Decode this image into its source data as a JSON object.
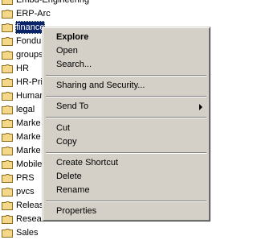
{
  "tree": {
    "folders": [
      {
        "label": "Embd-Engineering",
        "selected": false
      },
      {
        "label": "ERP-Arc",
        "selected": false
      },
      {
        "label": "finance",
        "selected": true
      },
      {
        "label": "Fondu",
        "selected": false
      },
      {
        "label": "groups",
        "selected": false
      },
      {
        "label": "HR",
        "selected": false
      },
      {
        "label": "HR-Pri",
        "selected": false
      },
      {
        "label": "Human",
        "selected": false
      },
      {
        "label": "legal",
        "selected": false
      },
      {
        "label": "Marke",
        "selected": false
      },
      {
        "label": "Marke",
        "selected": false
      },
      {
        "label": "Marke",
        "selected": false
      },
      {
        "label": "Mobile",
        "selected": false
      },
      {
        "label": "PRS",
        "selected": false
      },
      {
        "label": "pvcs",
        "selected": false
      },
      {
        "label": "Releas",
        "selected": false
      },
      {
        "label": "Resear",
        "selected": false
      },
      {
        "label": "Sales",
        "selected": false
      }
    ],
    "folder_icon": "folder-icon",
    "folder_color": "#f5d78a"
  },
  "context_menu": {
    "explore": "Explore",
    "open": "Open",
    "search": "Search...",
    "sharing_security": "Sharing and Security...",
    "send_to": "Send To",
    "cut": "Cut",
    "copy": "Copy",
    "create_shortcut": "Create Shortcut",
    "delete": "Delete",
    "rename": "Rename",
    "properties": "Properties",
    "submenu_icon": "submenu-arrow-icon"
  },
  "colors": {
    "menu_background": "#d4d0c8",
    "selection": "#0a246a"
  }
}
